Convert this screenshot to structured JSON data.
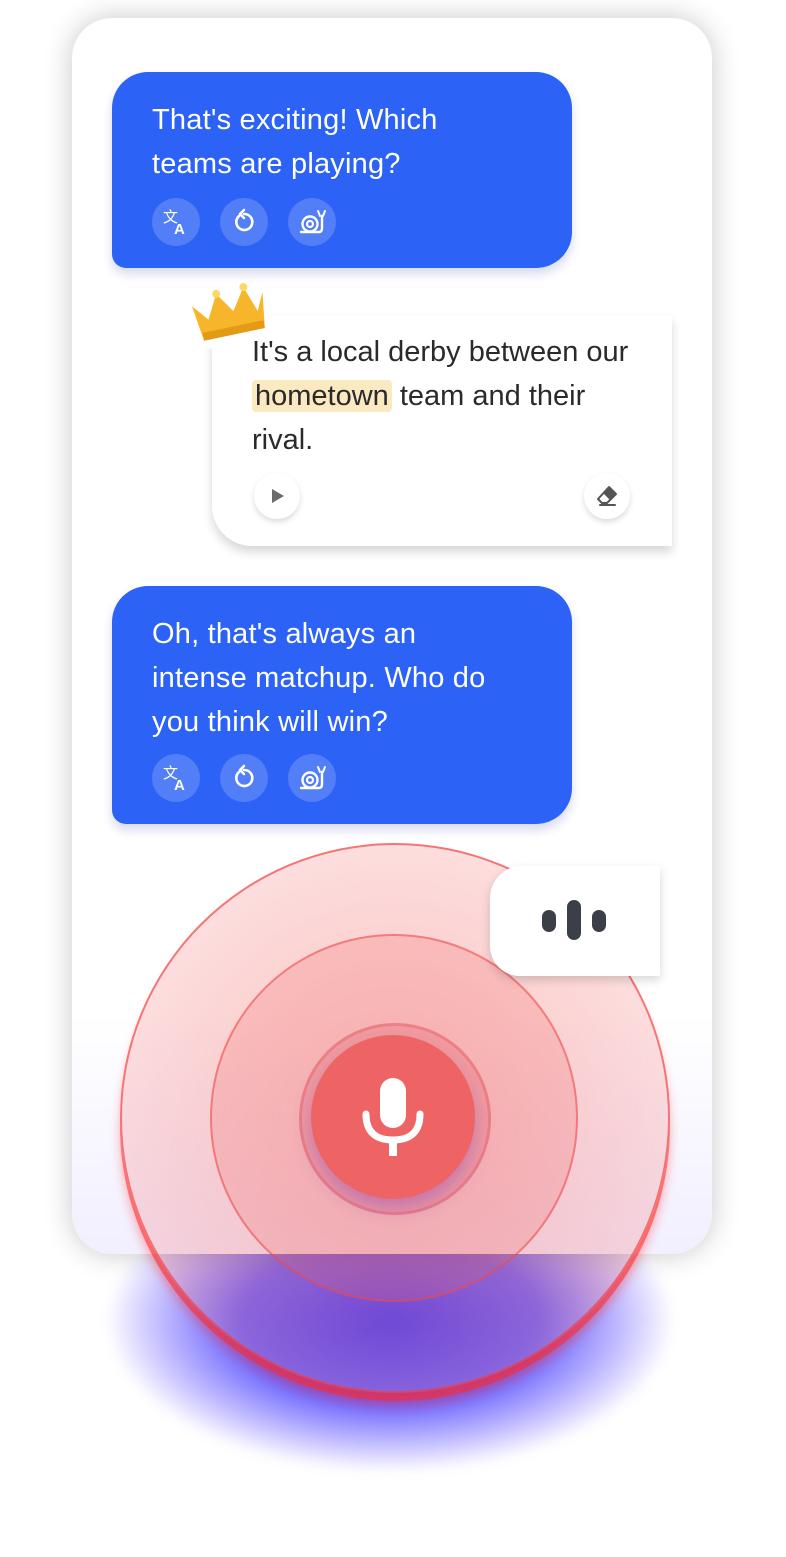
{
  "messages": [
    {
      "role": "ai",
      "lines": [
        "That's exciting! Which",
        "teams are playing?"
      ]
    },
    {
      "role": "user",
      "text_before": "It's a local derby between our ",
      "highlight": "hometown",
      "text_after": " team and their rival."
    },
    {
      "role": "ai",
      "lines": [
        "Oh, that's always an",
        "intense matchup. Who do",
        "you think will win?"
      ]
    }
  ],
  "icons": {
    "translate": "translate-icon",
    "replay": "replay-icon",
    "slow": "snail-icon",
    "play": "play-icon",
    "erase": "eraser-icon",
    "crown": "crown-icon",
    "waves": "voice-wave-icon",
    "mic": "microphone-icon"
  },
  "colors": {
    "ai_bubble": "#2c62f6",
    "highlight": "#fbe9c2",
    "mic": "#ee6464",
    "ring": "#f06060",
    "glow": "#2828ff"
  }
}
